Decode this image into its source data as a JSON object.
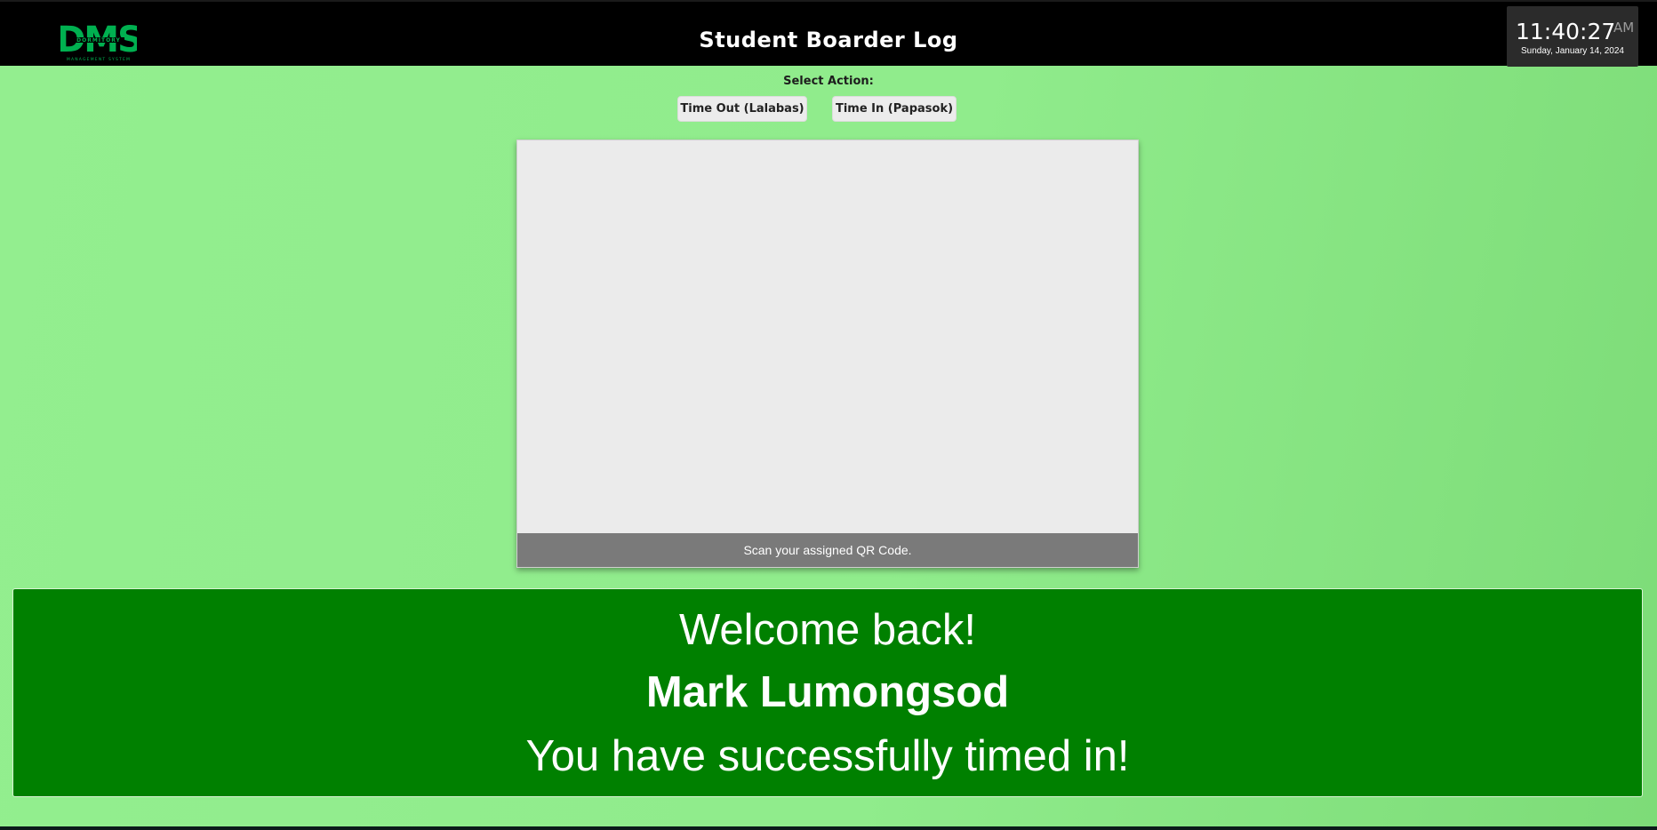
{
  "header": {
    "logo_text": "DMS",
    "logo_subtext": "DORMITORY",
    "logo_tagline": "MANAGEMENT SYSTEM",
    "title": "Student Boarder Log",
    "clock": {
      "time": "11:40:27",
      "ampm": "AM",
      "date": "Sunday, January 14, 2024"
    }
  },
  "actions": {
    "label": "Select Action:",
    "time_out_label": "Time Out (Lalabas)",
    "time_in_label": "Time In (Papasok)"
  },
  "scanner": {
    "caption": "Scan your assigned QR Code."
  },
  "result": {
    "greeting": "Welcome back!",
    "name": "Mark Lumongsod",
    "message": "You have successfully timed in!"
  },
  "colors": {
    "accent": "#00b050",
    "success_panel": "#008000",
    "header_bg": "#000000"
  }
}
